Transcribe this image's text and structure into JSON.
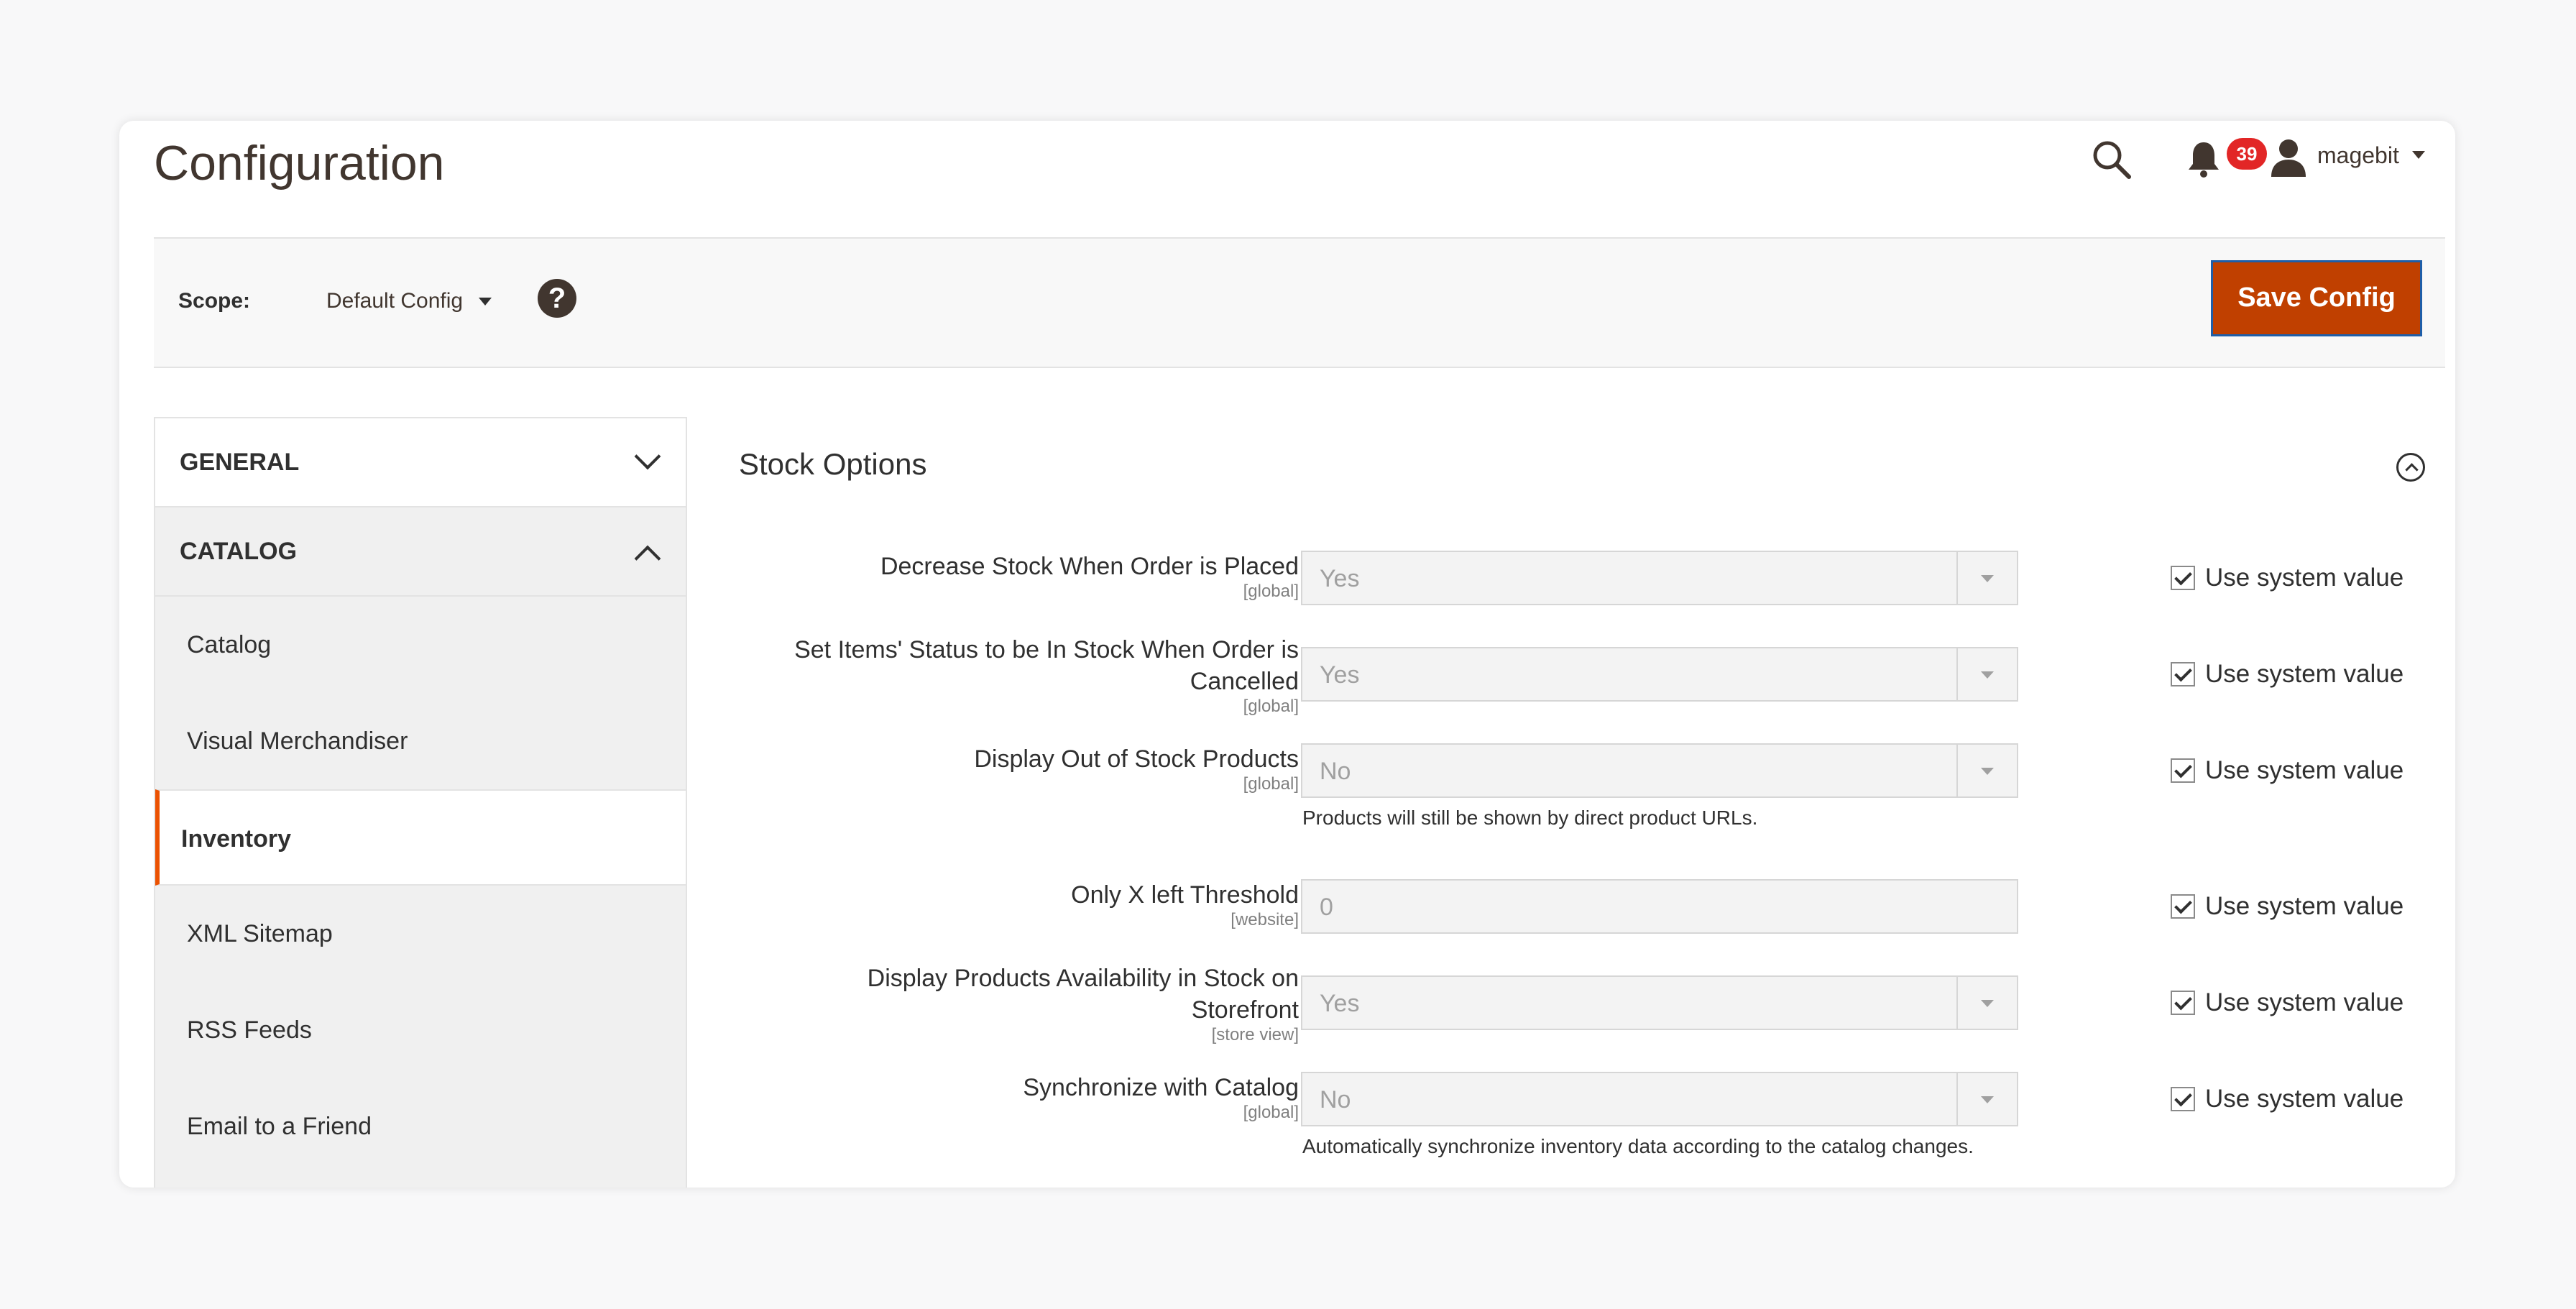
{
  "page": {
    "title": "Configuration"
  },
  "header": {
    "notifications_count": "39",
    "user_name": "magebit"
  },
  "scope": {
    "label": "Scope:",
    "value": "Default Config",
    "help": "?",
    "save_button": "Save Config"
  },
  "sidebar": {
    "sections": [
      {
        "label": "GENERAL",
        "expanded": false
      },
      {
        "label": "CATALOG",
        "expanded": true
      }
    ],
    "items": [
      {
        "label": "Catalog"
      },
      {
        "label": "Visual Merchandiser"
      },
      {
        "label": "Inventory",
        "active": true
      },
      {
        "label": "XML Sitemap"
      },
      {
        "label": "RSS Feeds"
      },
      {
        "label": "Email to a Friend"
      }
    ]
  },
  "content": {
    "section_title": "Stock Options",
    "rows": [
      {
        "label": "Decrease Stock When Order is Placed",
        "scope": "[global]",
        "value": "Yes",
        "system": "Use system value"
      },
      {
        "label": "Set Items' Status to be In Stock When Order is Cancelled",
        "scope": "[global]",
        "value": "Yes",
        "system": "Use system value"
      },
      {
        "label": "Display Out of Stock Products",
        "scope": "[global]",
        "value": "No",
        "system": "Use system value",
        "note": "Products will still be shown by direct product URLs."
      },
      {
        "label": "Only X left Threshold",
        "scope": "[website]",
        "value": "0",
        "system": "Use system value"
      },
      {
        "label": "Display Products Availability in Stock on Storefront",
        "scope": "[store view]",
        "value": "Yes",
        "system": "Use system value"
      },
      {
        "label": "Synchronize with Catalog",
        "scope": "[global]",
        "value": "No",
        "system": "Use system value",
        "note": "Automatically synchronize inventory data according to the catalog changes."
      }
    ]
  }
}
